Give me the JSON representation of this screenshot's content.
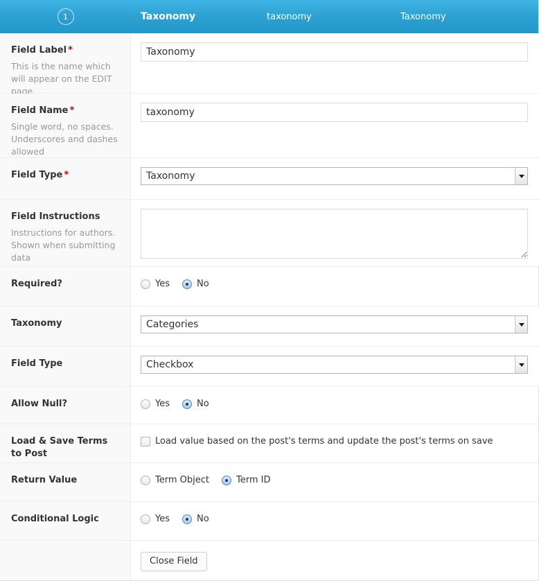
{
  "header": {
    "order_number": "1",
    "label": "Taxonomy",
    "name": "taxonomy",
    "type": "Taxonomy",
    "accent_color": "#2ba0d0"
  },
  "rows": {
    "field_label": {
      "title": "Field Label",
      "required_mark": "*",
      "description": "This is the name which will appear on the EDIT page",
      "value": "Taxonomy",
      "placeholder": ""
    },
    "field_name": {
      "title": "Field Name",
      "required_mark": "*",
      "description": "Single word, no spaces. Underscores and dashes allowed",
      "value": "taxonomy",
      "placeholder": ""
    },
    "field_type": {
      "title": "Field Type",
      "required_mark": "*",
      "selected": "Taxonomy"
    },
    "field_instructions": {
      "title": "Field Instructions",
      "description": "Instructions for authors. Shown when submitting data",
      "value": "",
      "placeholder": ""
    },
    "required": {
      "title": "Required?",
      "options": [
        {
          "label": "Yes",
          "selected": false
        },
        {
          "label": "No",
          "selected": true
        }
      ]
    },
    "taxonomy": {
      "title": "Taxonomy",
      "selected": "Categories"
    },
    "appearance_field_type": {
      "title": "Field Type",
      "selected": "Checkbox"
    },
    "allow_null": {
      "title": "Allow Null?",
      "options": [
        {
          "label": "Yes",
          "selected": false
        },
        {
          "label": "No",
          "selected": true
        }
      ]
    },
    "load_save_terms": {
      "title": "Load & Save Terms to Post",
      "checkbox_label": "Load value based on the post's terms and update the post's terms on save",
      "checked": false
    },
    "return_value": {
      "title": "Return Value",
      "options": [
        {
          "label": "Term Object",
          "selected": false
        },
        {
          "label": "Term ID",
          "selected": true
        }
      ]
    },
    "conditional_logic": {
      "title": "Conditional Logic",
      "options": [
        {
          "label": "Yes",
          "selected": false
        },
        {
          "label": "No",
          "selected": true
        }
      ]
    }
  },
  "footer": {
    "close_button": "Close Field"
  }
}
